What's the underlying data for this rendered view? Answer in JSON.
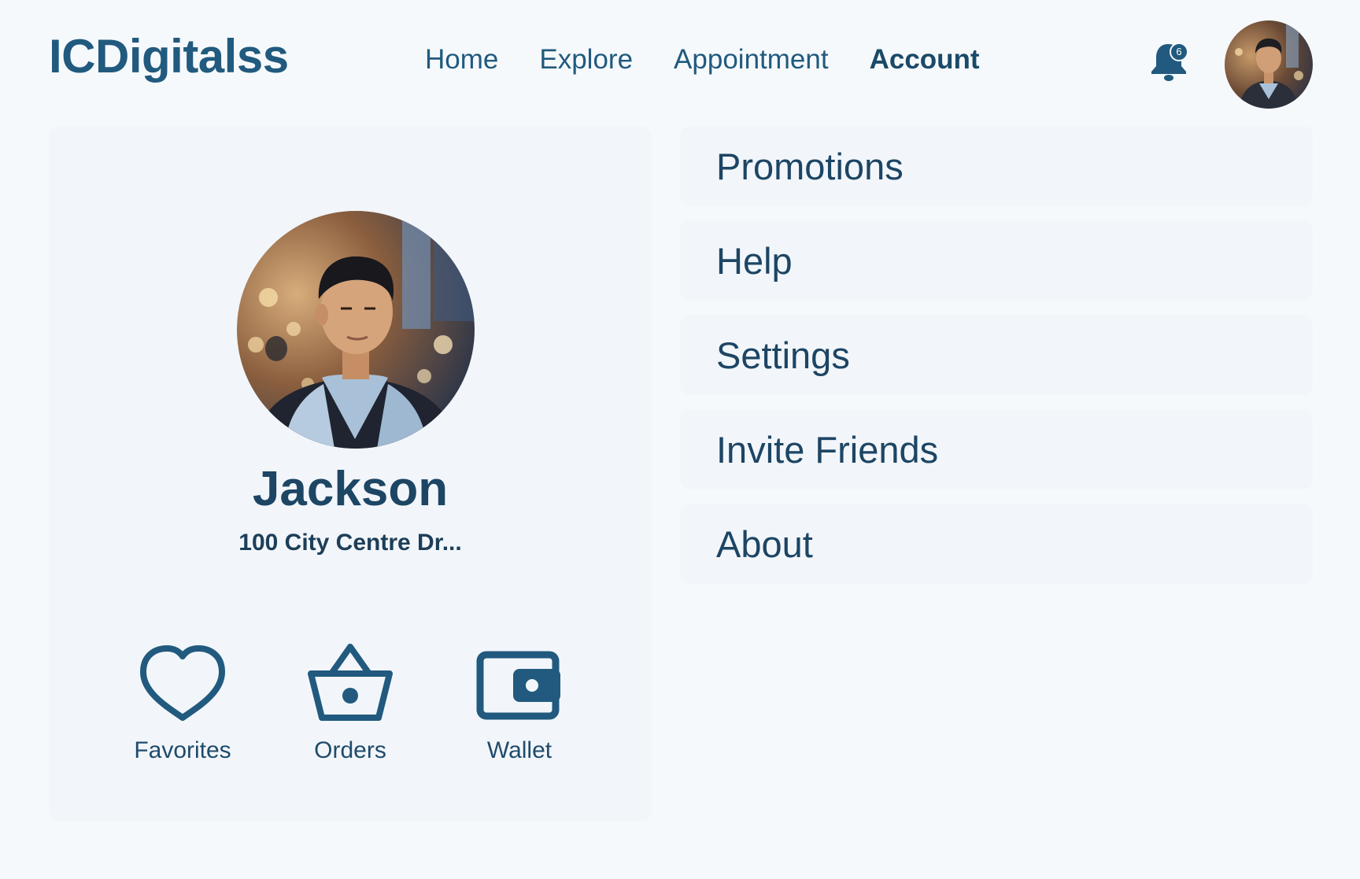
{
  "header": {
    "logo": "ICDigitalss",
    "nav": [
      "Home",
      "Explore",
      "Appointment",
      "Account"
    ],
    "active_nav": "Account",
    "notification_count": "6"
  },
  "profile": {
    "name": "Jackson",
    "address": "100 City Centre Dr..."
  },
  "quick_actions": [
    {
      "label": "Favorites",
      "icon": "heart-icon"
    },
    {
      "label": "Orders",
      "icon": "basket-icon"
    },
    {
      "label": "Wallet",
      "icon": "wallet-icon"
    }
  ],
  "menu": [
    "Promotions",
    "Help",
    "Settings",
    "Invite Friends",
    "About"
  ],
  "colors": {
    "primary": "#215a7e",
    "background": "#f6f9fc",
    "card": "#f2f6fa"
  }
}
